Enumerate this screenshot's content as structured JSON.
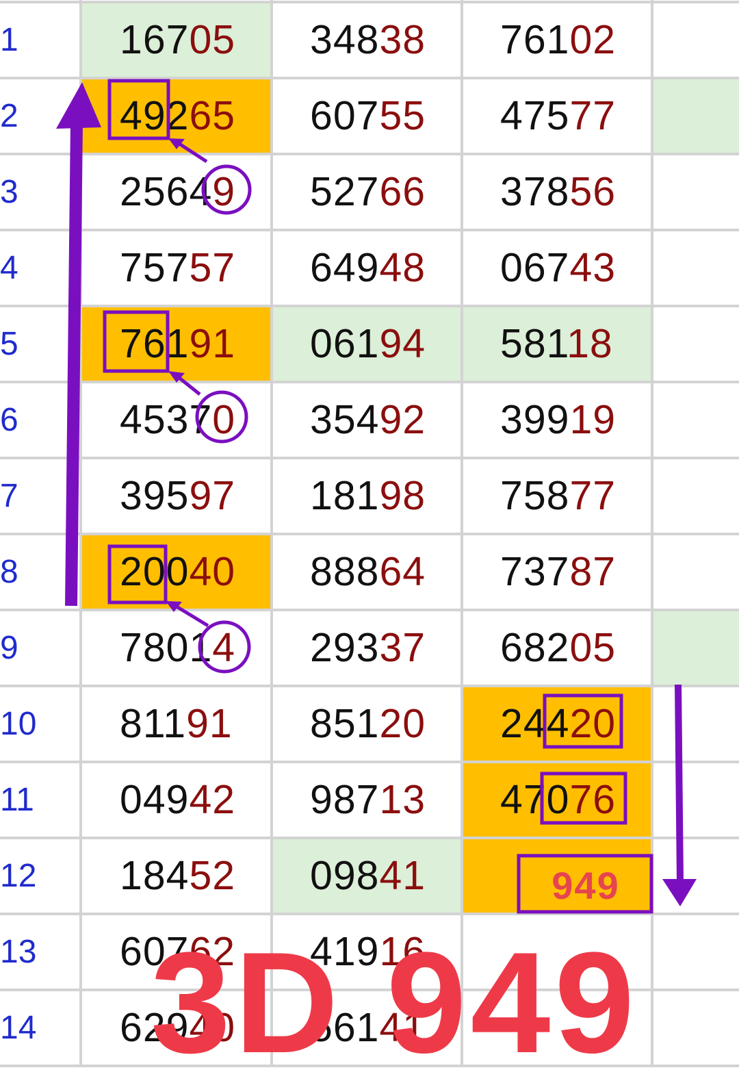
{
  "rows": [
    {
      "n": "1",
      "c": [
        [
          "167",
          "05"
        ],
        [
          "348",
          "38"
        ],
        [
          "761",
          "02"
        ]
      ]
    },
    {
      "n": "2",
      "c": [
        [
          "492",
          "65"
        ],
        [
          "607",
          "55"
        ],
        [
          "475",
          "77"
        ]
      ]
    },
    {
      "n": "3",
      "c": [
        [
          "2564",
          "9"
        ],
        [
          "527",
          "66"
        ],
        [
          "378",
          "56"
        ]
      ]
    },
    {
      "n": "4",
      "c": [
        [
          "757",
          "57"
        ],
        [
          "649",
          "48"
        ],
        [
          "067",
          "43"
        ]
      ]
    },
    {
      "n": "5",
      "c": [
        [
          "761",
          "91"
        ],
        [
          "061",
          "94"
        ],
        [
          "581",
          "18"
        ]
      ]
    },
    {
      "n": "6",
      "c": [
        [
          "4537",
          "0"
        ],
        [
          "354",
          "92"
        ],
        [
          "399",
          "19"
        ]
      ]
    },
    {
      "n": "7",
      "c": [
        [
          "395",
          "97"
        ],
        [
          "181",
          "98"
        ],
        [
          "758",
          "77"
        ]
      ]
    },
    {
      "n": "8",
      "c": [
        [
          "200",
          "40"
        ],
        [
          "888",
          "64"
        ],
        [
          "737",
          "87"
        ]
      ]
    },
    {
      "n": "9",
      "c": [
        [
          "7801",
          "4"
        ],
        [
          "293",
          "37"
        ],
        [
          "682",
          "05"
        ]
      ]
    },
    {
      "n": "10",
      "c": [
        [
          "811",
          "91"
        ],
        [
          "851",
          "20"
        ],
        [
          "244",
          "20"
        ]
      ]
    },
    {
      "n": "11",
      "c": [
        [
          "049",
          "42"
        ],
        [
          "987",
          "13"
        ],
        [
          "470",
          "76"
        ]
      ]
    },
    {
      "n": "12",
      "c": [
        [
          "184",
          "52"
        ],
        [
          "098",
          "41"
        ],
        [
          "",
          ""
        ]
      ]
    },
    {
      "n": "13",
      "c": [
        [
          "607",
          "62"
        ],
        [
          "419",
          "16"
        ],
        [
          "",
          ""
        ]
      ]
    },
    {
      "n": "14",
      "c": [
        [
          "629",
          "40"
        ],
        [
          "561",
          "41"
        ],
        [
          "",
          ""
        ]
      ]
    }
  ],
  "result_box": "949",
  "big_label": "3D 949",
  "colors": {
    "highlight": "#ffbf00",
    "green": "#dcefd8",
    "annotation": "#7a0fc0",
    "suffix": "#8b0e0e",
    "rownum": "#1f2bcc",
    "big_label": "#ee3a48"
  }
}
